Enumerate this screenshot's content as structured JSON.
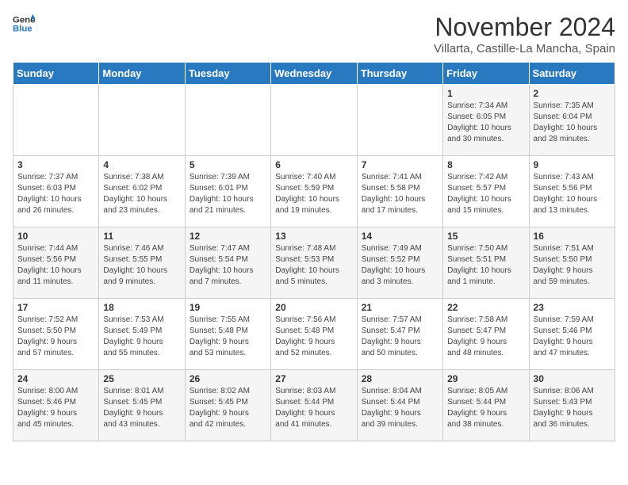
{
  "header": {
    "logo_line1": "General",
    "logo_line2": "Blue",
    "month": "November 2024",
    "location": "Villarta, Castille-La Mancha, Spain"
  },
  "days_of_week": [
    "Sunday",
    "Monday",
    "Tuesday",
    "Wednesday",
    "Thursday",
    "Friday",
    "Saturday"
  ],
  "weeks": [
    [
      {
        "day": "",
        "info": ""
      },
      {
        "day": "",
        "info": ""
      },
      {
        "day": "",
        "info": ""
      },
      {
        "day": "",
        "info": ""
      },
      {
        "day": "",
        "info": ""
      },
      {
        "day": "1",
        "info": "Sunrise: 7:34 AM\nSunset: 6:05 PM\nDaylight: 10 hours\nand 30 minutes."
      },
      {
        "day": "2",
        "info": "Sunrise: 7:35 AM\nSunset: 6:04 PM\nDaylight: 10 hours\nand 28 minutes."
      }
    ],
    [
      {
        "day": "3",
        "info": "Sunrise: 7:37 AM\nSunset: 6:03 PM\nDaylight: 10 hours\nand 26 minutes."
      },
      {
        "day": "4",
        "info": "Sunrise: 7:38 AM\nSunset: 6:02 PM\nDaylight: 10 hours\nand 23 minutes."
      },
      {
        "day": "5",
        "info": "Sunrise: 7:39 AM\nSunset: 6:01 PM\nDaylight: 10 hours\nand 21 minutes."
      },
      {
        "day": "6",
        "info": "Sunrise: 7:40 AM\nSunset: 5:59 PM\nDaylight: 10 hours\nand 19 minutes."
      },
      {
        "day": "7",
        "info": "Sunrise: 7:41 AM\nSunset: 5:58 PM\nDaylight: 10 hours\nand 17 minutes."
      },
      {
        "day": "8",
        "info": "Sunrise: 7:42 AM\nSunset: 5:57 PM\nDaylight: 10 hours\nand 15 minutes."
      },
      {
        "day": "9",
        "info": "Sunrise: 7:43 AM\nSunset: 5:56 PM\nDaylight: 10 hours\nand 13 minutes."
      }
    ],
    [
      {
        "day": "10",
        "info": "Sunrise: 7:44 AM\nSunset: 5:56 PM\nDaylight: 10 hours\nand 11 minutes."
      },
      {
        "day": "11",
        "info": "Sunrise: 7:46 AM\nSunset: 5:55 PM\nDaylight: 10 hours\nand 9 minutes."
      },
      {
        "day": "12",
        "info": "Sunrise: 7:47 AM\nSunset: 5:54 PM\nDaylight: 10 hours\nand 7 minutes."
      },
      {
        "day": "13",
        "info": "Sunrise: 7:48 AM\nSunset: 5:53 PM\nDaylight: 10 hours\nand 5 minutes."
      },
      {
        "day": "14",
        "info": "Sunrise: 7:49 AM\nSunset: 5:52 PM\nDaylight: 10 hours\nand 3 minutes."
      },
      {
        "day": "15",
        "info": "Sunrise: 7:50 AM\nSunset: 5:51 PM\nDaylight: 10 hours\nand 1 minute."
      },
      {
        "day": "16",
        "info": "Sunrise: 7:51 AM\nSunset: 5:50 PM\nDaylight: 9 hours\nand 59 minutes."
      }
    ],
    [
      {
        "day": "17",
        "info": "Sunrise: 7:52 AM\nSunset: 5:50 PM\nDaylight: 9 hours\nand 57 minutes."
      },
      {
        "day": "18",
        "info": "Sunrise: 7:53 AM\nSunset: 5:49 PM\nDaylight: 9 hours\nand 55 minutes."
      },
      {
        "day": "19",
        "info": "Sunrise: 7:55 AM\nSunset: 5:48 PM\nDaylight: 9 hours\nand 53 minutes."
      },
      {
        "day": "20",
        "info": "Sunrise: 7:56 AM\nSunset: 5:48 PM\nDaylight: 9 hours\nand 52 minutes."
      },
      {
        "day": "21",
        "info": "Sunrise: 7:57 AM\nSunset: 5:47 PM\nDaylight: 9 hours\nand 50 minutes."
      },
      {
        "day": "22",
        "info": "Sunrise: 7:58 AM\nSunset: 5:47 PM\nDaylight: 9 hours\nand 48 minutes."
      },
      {
        "day": "23",
        "info": "Sunrise: 7:59 AM\nSunset: 5:46 PM\nDaylight: 9 hours\nand 47 minutes."
      }
    ],
    [
      {
        "day": "24",
        "info": "Sunrise: 8:00 AM\nSunset: 5:46 PM\nDaylight: 9 hours\nand 45 minutes."
      },
      {
        "day": "25",
        "info": "Sunrise: 8:01 AM\nSunset: 5:45 PM\nDaylight: 9 hours\nand 43 minutes."
      },
      {
        "day": "26",
        "info": "Sunrise: 8:02 AM\nSunset: 5:45 PM\nDaylight: 9 hours\nand 42 minutes."
      },
      {
        "day": "27",
        "info": "Sunrise: 8:03 AM\nSunset: 5:44 PM\nDaylight: 9 hours\nand 41 minutes."
      },
      {
        "day": "28",
        "info": "Sunrise: 8:04 AM\nSunset: 5:44 PM\nDaylight: 9 hours\nand 39 minutes."
      },
      {
        "day": "29",
        "info": "Sunrise: 8:05 AM\nSunset: 5:44 PM\nDaylight: 9 hours\nand 38 minutes."
      },
      {
        "day": "30",
        "info": "Sunrise: 8:06 AM\nSunset: 5:43 PM\nDaylight: 9 hours\nand 36 minutes."
      }
    ]
  ]
}
